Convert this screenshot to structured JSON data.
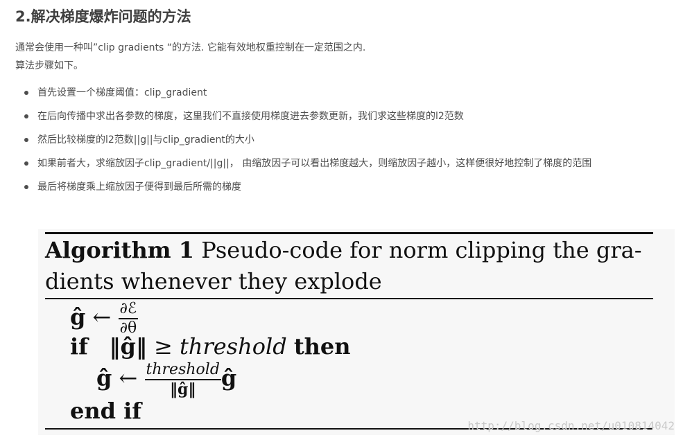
{
  "heading": "2.解决梯度爆炸问题的方法",
  "intro": {
    "line1": "通常会使用一种叫”clip gradients “的方法. 它能有效地权重控制在一定范围之内.",
    "line2": "算法步骤如下。"
  },
  "steps": [
    "首先设置一个梯度阈值：clip_gradient",
    "在后向传播中求出各参数的梯度，这里我们不直接使用梯度进去参数更新，我们求这些梯度的l2范数",
    "然后比较梯度的l2范数||g||与clip_gradient的大小",
    "如果前者大，求缩放因子clip_gradient/||g||， 由缩放因子可以看出梯度越大，则缩放因子越小，这样便很好地控制了梯度的范围",
    "最后将梯度乘上缩放因子便得到最后所需的梯度"
  ],
  "algorithm": {
    "label": "Algorithm 1",
    "caption_line1": " Pseudo-code for norm clipping the gra-",
    "caption_line2": "dients whenever they explode",
    "ghat": "ĝ",
    "arrow": "←",
    "grad_num": "∂ℰ",
    "grad_den": "∂θ",
    "kw_if": "if",
    "norm_ghat": "‖ĝ‖",
    "geq": "≥",
    "threshold": "threshold",
    "kw_then": "then",
    "frac_den": "‖ĝ‖",
    "kw_endif": "end if"
  },
  "watermark": "http://blog.csdn.net/u010814042"
}
